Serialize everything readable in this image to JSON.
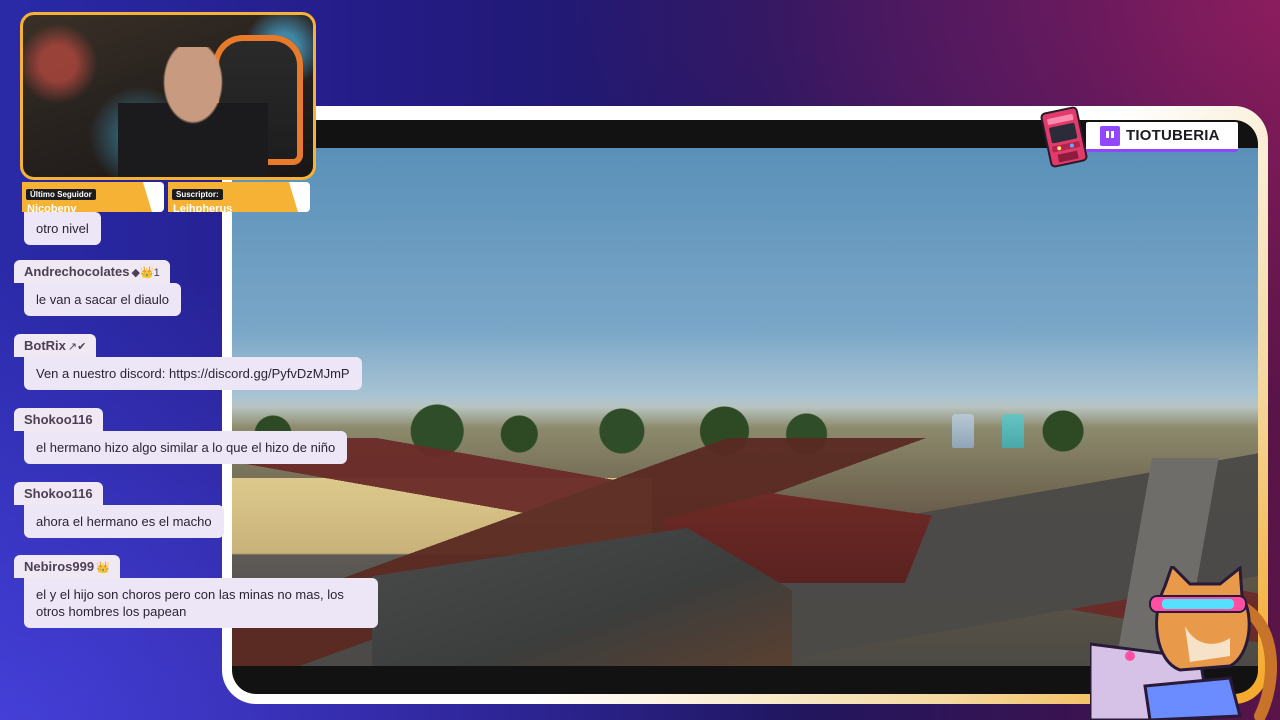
{
  "overlay": {
    "brand_name": "TIOTUBERIA",
    "colors": {
      "accent_gold": "#f6b234",
      "twitch_purple": "#9146ff",
      "chat_bubble": "#ece6f6"
    }
  },
  "alerts": [
    {
      "label": "Último Seguidor",
      "value": "Nicobeny"
    },
    {
      "label": "Suscriptor:",
      "value": "Leihpherus"
    }
  ],
  "chat": {
    "messages": [
      {
        "user": "",
        "text": "otro nivel"
      },
      {
        "user": "Andrechocolates",
        "badges": "◆👑1",
        "text": "le van a sacar el diaulo"
      },
      {
        "user": "BotRix",
        "badges": "↗✔",
        "text": "Ven a nuestro discord: https://discord.gg/PyfvDzMJmP"
      },
      {
        "user": "Shokoo116",
        "badges": "",
        "text": "el hermano hizo algo similar a lo que el hizo de niño"
      },
      {
        "user": "Shokoo116",
        "badges": "",
        "text": "ahora el hermano es el macho"
      },
      {
        "user": "Nebiros999",
        "badges": "👑",
        "text": "el y el hijo son choros pero con las minas no mas, los otros hombres los papean"
      }
    ]
  },
  "icons": {
    "twitch": "twitch-icon",
    "arcade": "arcade-cabinet-icon",
    "mascot": "cat-mascot-icon"
  }
}
